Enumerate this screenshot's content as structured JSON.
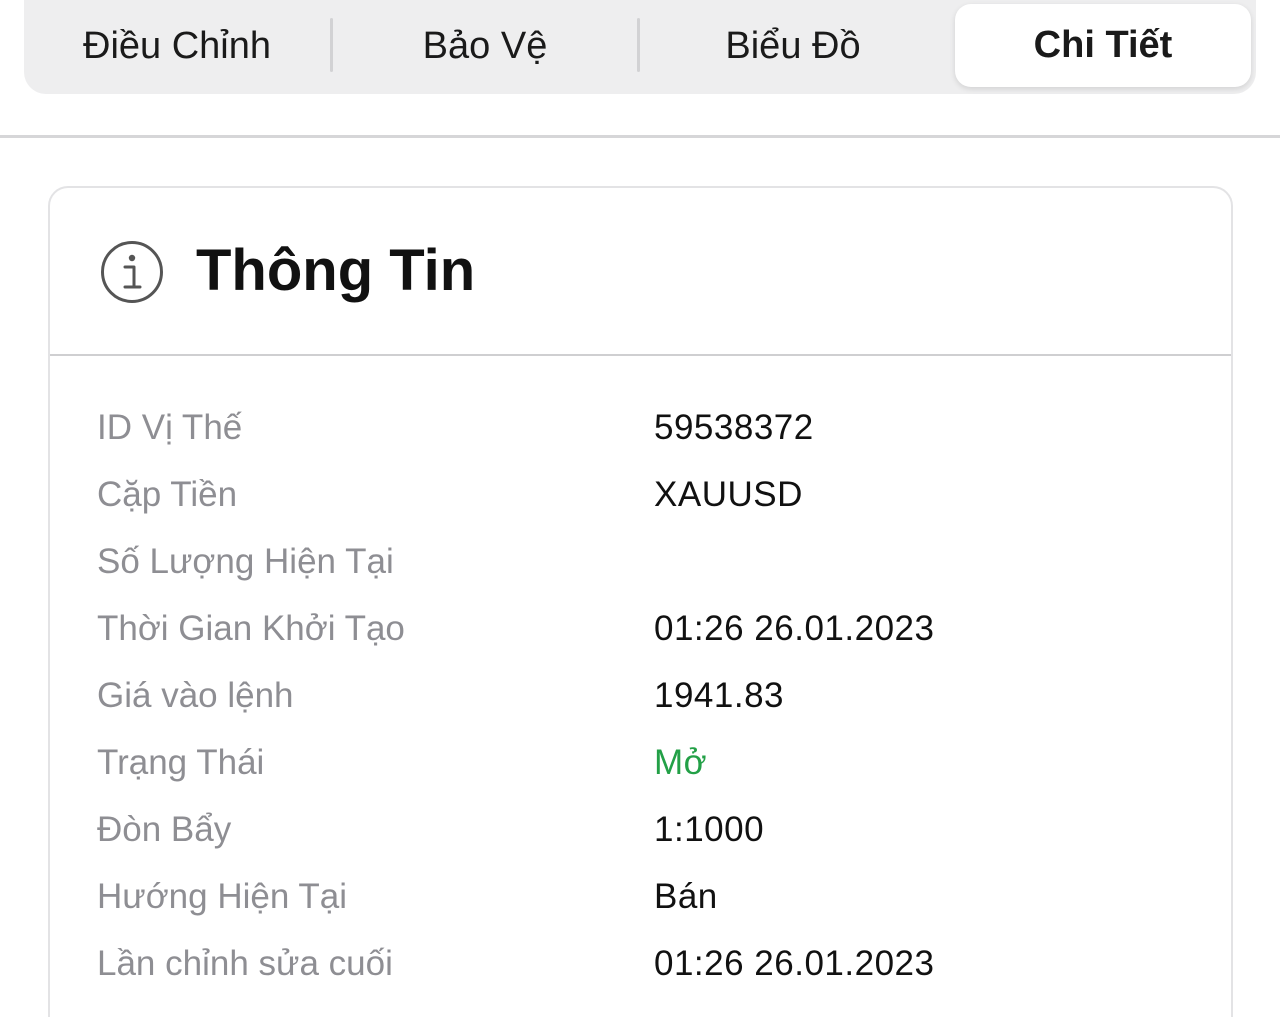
{
  "tabs": [
    {
      "label": "Điều Chỉnh",
      "active": false
    },
    {
      "label": "Bảo Vệ",
      "active": false
    },
    {
      "label": "Biểu Đồ",
      "active": false
    },
    {
      "label": "Chi Tiết",
      "active": true
    }
  ],
  "card": {
    "icon": "info-circle-icon",
    "title": "Thông Tin"
  },
  "details": [
    {
      "label": "ID Vị Thế",
      "value": "59538372"
    },
    {
      "label": "Cặp Tiền",
      "value": "XAUUSD"
    },
    {
      "label": "Số Lượng Hiện Tại",
      "value": ""
    },
    {
      "label": "Thời Gian Khởi Tạo",
      "value": "01:26 26.01.2023"
    },
    {
      "label": "Giá vào lệnh",
      "value": "1941.83"
    },
    {
      "label": "Trạng Thái",
      "value": "Mở"
    },
    {
      "label": "Đòn Bẩy",
      "value": "1:1000"
    },
    {
      "label": "Hướng Hiện Tại",
      "value": "Bán"
    },
    {
      "label": "Lần chỉnh sửa cuối",
      "value": "01:26 26.01.2023"
    }
  ],
  "colors": {
    "status_open": "#23a047",
    "label_gray": "#8e8e93",
    "tab_bg": "#eeeeef"
  }
}
